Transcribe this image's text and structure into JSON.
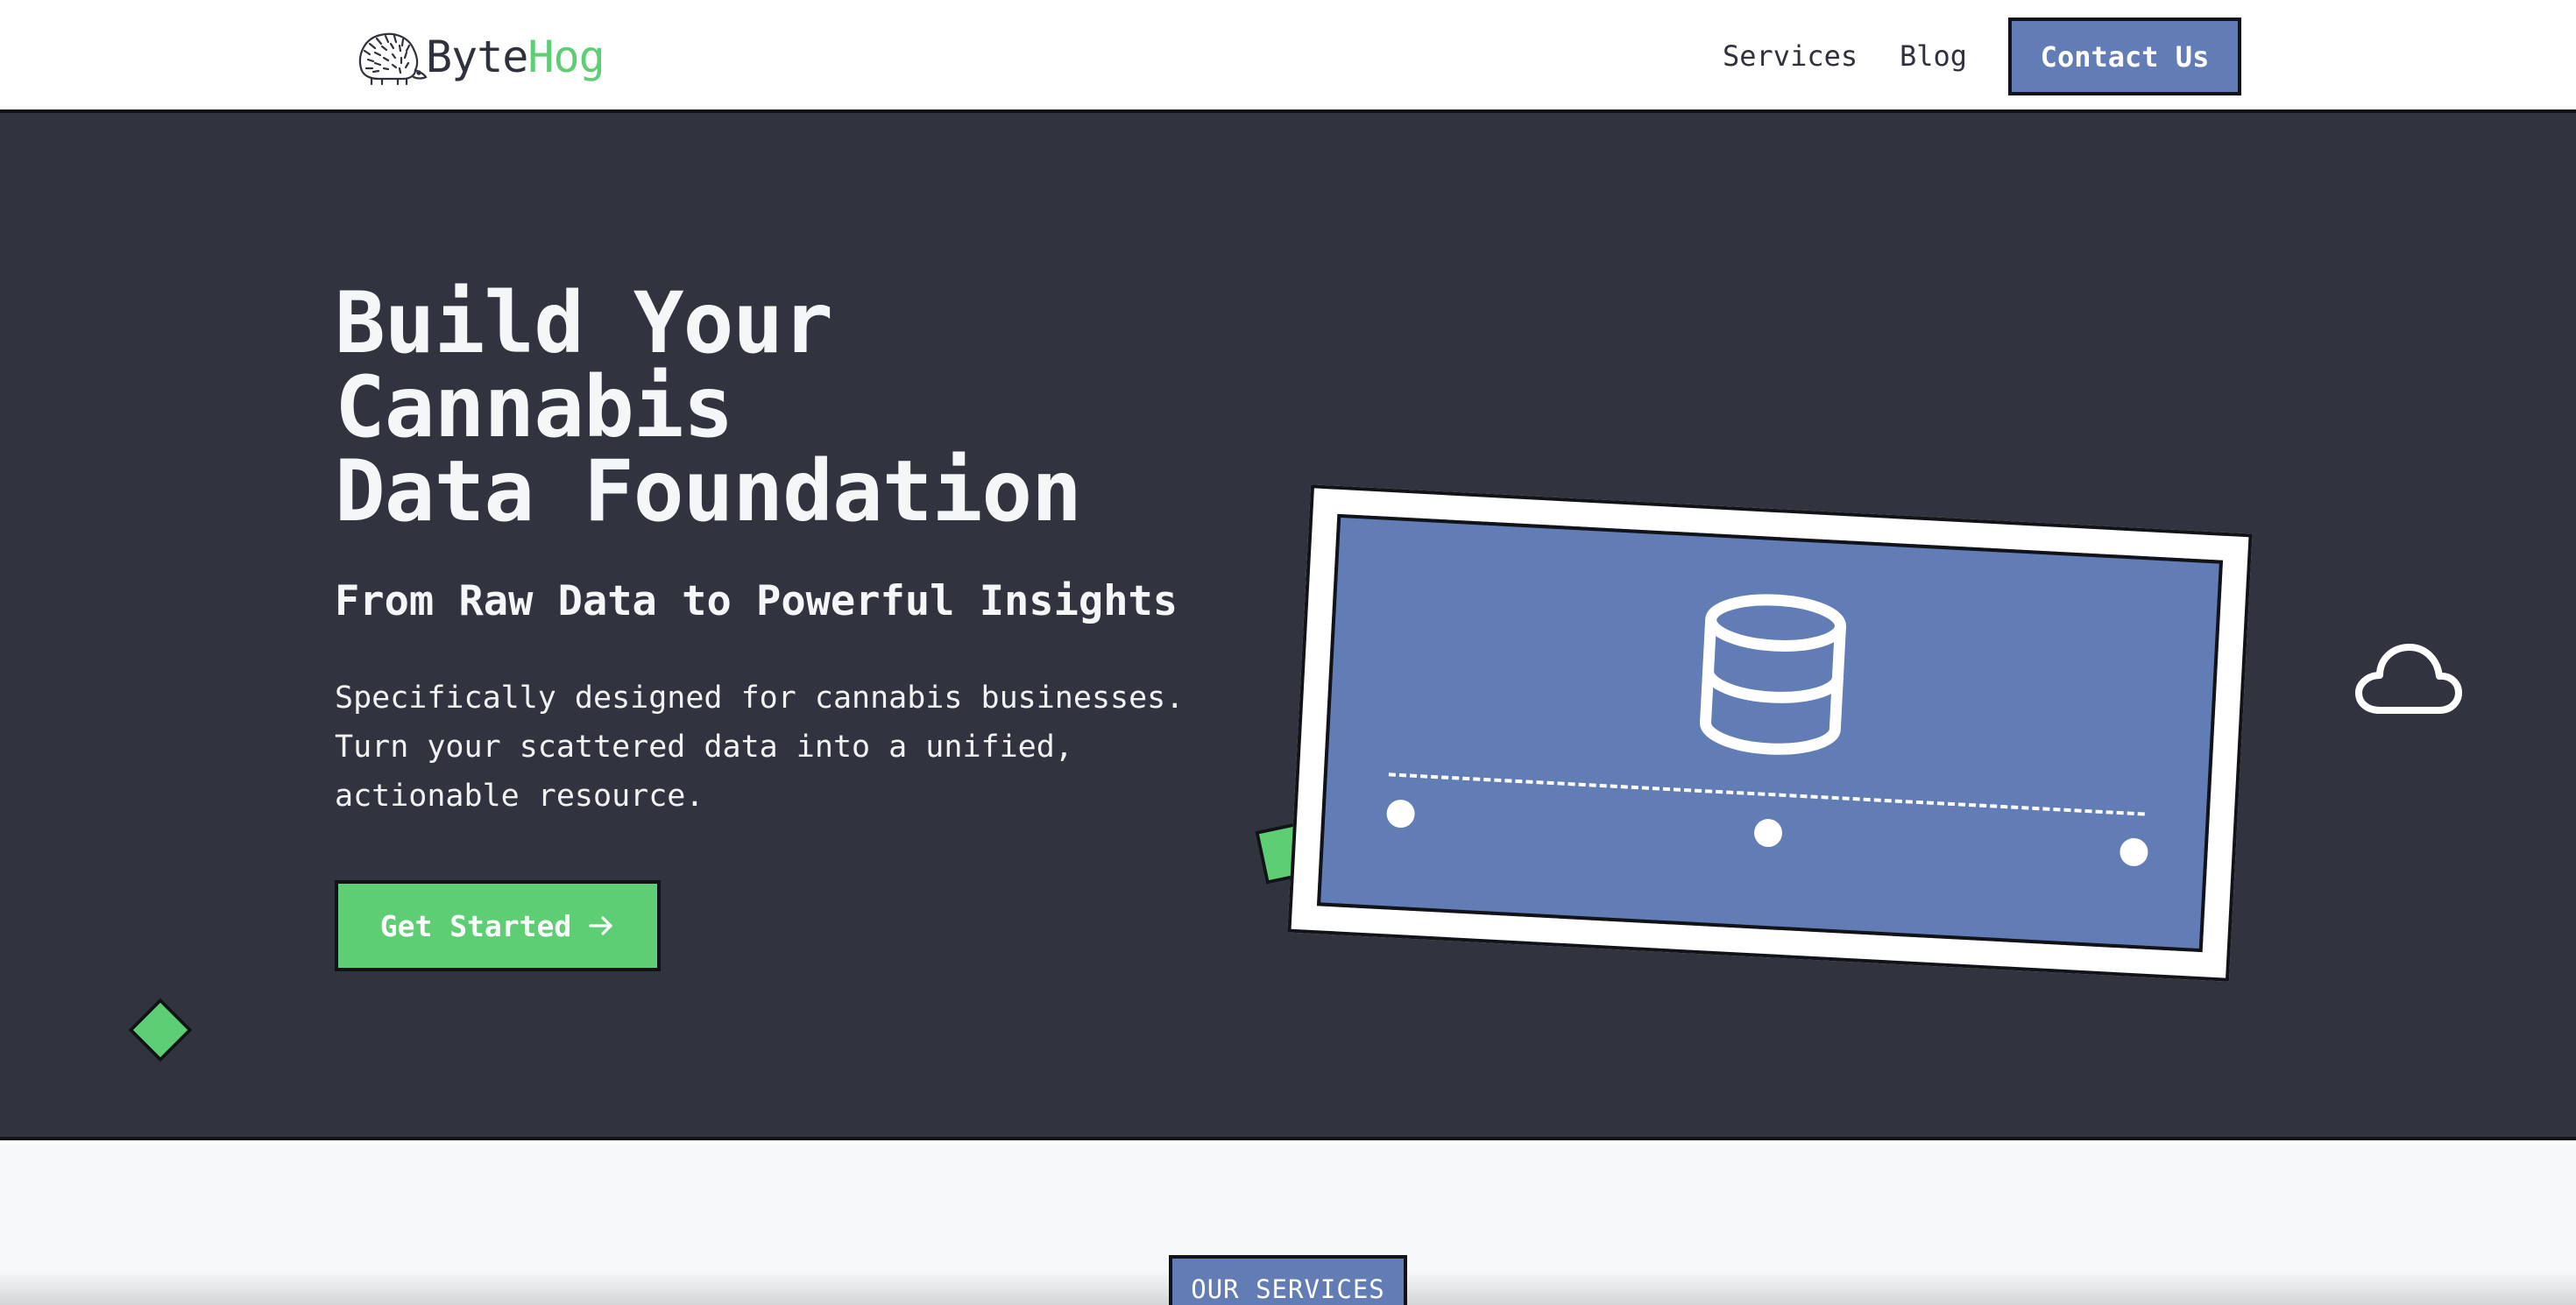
{
  "nav": {
    "logo": {
      "word_byte": "Byte",
      "word_hog": "Hog",
      "icon": "hedgehog-icon"
    },
    "links": [
      {
        "label": "Services"
      },
      {
        "label": "Blog"
      }
    ],
    "contact_label": "Contact Us"
  },
  "hero": {
    "title_lines": [
      "Build Your",
      "Cannabis",
      "Data Foundation"
    ],
    "subtitle": "From Raw Data to Powerful Insights",
    "description_lines": [
      "Specifically designed for cannabis businesses.",
      "Turn your scattered data into a unified,",
      "actionable resource."
    ],
    "cta_label": "Get Started",
    "cta_icon": "arrow-right-icon",
    "illustration_icon": "database-icon",
    "decor_icons": [
      "diamond-shape",
      "square-shape",
      "cloud-icon"
    ]
  },
  "services": {
    "badge": "OUR SERVICES"
  },
  "colors": {
    "brand_green": "#5ece74",
    "brand_blue": "#627db6",
    "hero_bg": "#31343e",
    "ink": "#111318",
    "section_bg": "#f7f8fa"
  }
}
